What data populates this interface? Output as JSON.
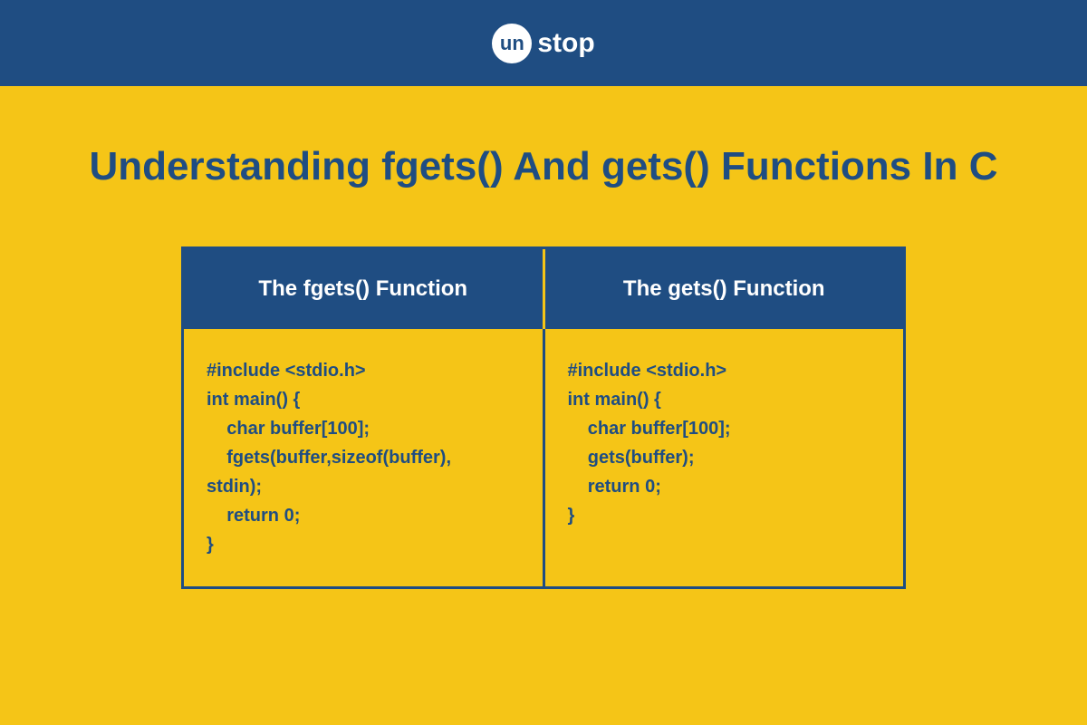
{
  "logo": {
    "circleText": "un",
    "suffix": "stop"
  },
  "title": "Understanding fgets() And gets() Functions In C",
  "table": {
    "columns": [
      {
        "header": "The fgets() Function",
        "code": "#include <stdio.h>\nint main() {\n    char buffer[100];\n    fgets(buffer,sizeof(buffer),\nstdin);\n    return 0;\n}"
      },
      {
        "header": "The gets() Function",
        "code": "#include <stdio.h>\nint main() {\n    char buffer[100];\n    gets(buffer);\n    return 0;\n}"
      }
    ]
  }
}
